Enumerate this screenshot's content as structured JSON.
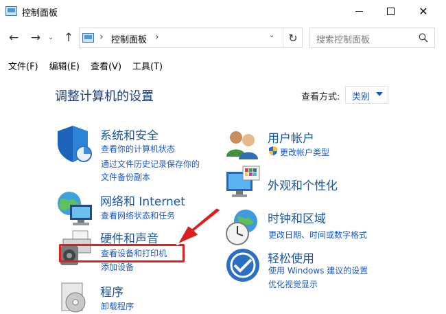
{
  "window": {
    "title": "控制面板",
    "minimize_glyph": "",
    "maximize_glyph": "",
    "close_glyph": "✕"
  },
  "nav": {
    "back_glyph": "←",
    "forward_glyph": "→",
    "recent_glyph": "⌄",
    "up_glyph": "↑"
  },
  "address": {
    "separator": "›",
    "path": "控制面板",
    "dropdown_glyph": "⌄",
    "refresh_glyph": "↻"
  },
  "search": {
    "placeholder": "搜索控制面板"
  },
  "menu": [
    "文件(F)",
    "编辑(E)",
    "查看(V)",
    "工具(T)"
  ],
  "main": {
    "heading": "调整计算机的设置",
    "view_by_label": "查看方式:",
    "view_by_value": "类别"
  },
  "categories_left": [
    {
      "title": "系统和安全",
      "icon": "shield-icon",
      "links": [
        "查看你的计算机状态",
        "通过文件历史记录保存你的",
        "文件备份副本"
      ]
    },
    {
      "title": "网络和 Internet",
      "icon": "network-globe-icon",
      "links": [
        "查看网络状态和任务"
      ]
    },
    {
      "title": "硬件和声音",
      "icon": "printer-speaker-icon",
      "links": [
        "查看设备和打印机",
        "添加设备"
      ]
    },
    {
      "title": "程序",
      "icon": "programs-disc-icon",
      "links": [
        "卸载程序"
      ]
    }
  ],
  "categories_right": [
    {
      "title": "用户帐户",
      "icon": "users-icon",
      "links": [
        "更改帐户类型"
      ]
    },
    {
      "title": "外观和个性化",
      "icon": "appearance-monitor-icon",
      "links": []
    },
    {
      "title": "时钟和区域",
      "icon": "clock-globe-icon",
      "links": [
        "更改日期、时间或数字格式"
      ]
    },
    {
      "title": "轻松使用",
      "icon": "ease-of-access-icon",
      "links": [
        "使用 Windows 建议的设置",
        "优化视觉显示"
      ]
    }
  ],
  "colors": {
    "link": "#1a58c7",
    "category_title": "#1a56a0",
    "highlight": "#e01f1f"
  }
}
